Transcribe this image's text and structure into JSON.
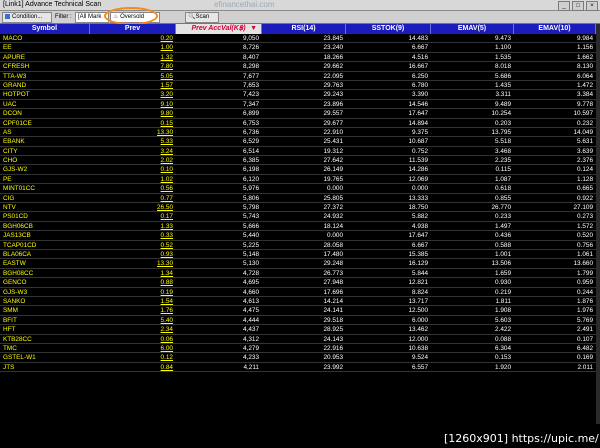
{
  "window": {
    "title": "[Link1] Advance Technical Scan",
    "watermark": "efinancethai.com"
  },
  "toolbar": {
    "condition_label": "Condition...",
    "filter_label": "Filter :",
    "market_value": "[All Mark",
    "oversold_label": "Oversold",
    "scan_label": "Scan"
  },
  "table": {
    "columns": [
      "Symbol",
      "Prev",
      "Prev AccVal(K฿)",
      "RSI(14)",
      "SSTOK(9)",
      "EMAV(5)",
      "EMAV(10)"
    ],
    "rows": [
      [
        "MACO",
        "0.20",
        "9,050",
        "23.845",
        "14.483",
        "9.473",
        "9.984"
      ],
      [
        "EE",
        "1.00",
        "8,726",
        "23.240",
        "6.667",
        "1.100",
        "1.156"
      ],
      [
        "APURE",
        "1.32",
        "8,407",
        "18.266",
        "4.516",
        "1.535",
        "1.662"
      ],
      [
        "CFRESH",
        "7.80",
        "8,298",
        "29.662",
        "16.667",
        "8.018",
        "8.130"
      ],
      [
        "TTA-W3",
        "5.05",
        "7,677",
        "22.095",
        "6.250",
        "5.686",
        "6.064"
      ],
      [
        "GRAND",
        "1.57",
        "7,653",
        "29.763",
        "6.780",
        "1.435",
        "1.472"
      ],
      [
        "HOTPOT",
        "3.20",
        "7,423",
        "29.243",
        "3.390",
        "3.311",
        "3.384"
      ],
      [
        "UAC",
        "9.10",
        "7,347",
        "23.896",
        "14.546",
        "9.489",
        "9.778"
      ],
      [
        "DCON",
        "9.80",
        "6,899",
        "29.557",
        "17.647",
        "10.254",
        "10.597"
      ],
      [
        "CPF01CE",
        "0.15",
        "6,753",
        "29.677",
        "14.894",
        "0.203",
        "0.232"
      ],
      [
        "AS",
        "13.30",
        "6,736",
        "22.910",
        "9.375",
        "13.795",
        "14.049"
      ],
      [
        "EBANK",
        "5.33",
        "6,529",
        "25.431",
        "10.687",
        "5.518",
        "5.631"
      ],
      [
        "CITY",
        "3.24",
        "6,514",
        "19.312",
        "0.752",
        "3.468",
        "3.639"
      ],
      [
        "CHO",
        "2.02",
        "6,385",
        "27.642",
        "11.539",
        "2.235",
        "2.376"
      ],
      [
        "GJS-W2",
        "0.10",
        "6,198",
        "26.149",
        "14.286",
        "0.115",
        "0.124"
      ],
      [
        "PE",
        "1.02",
        "6,120",
        "19.765",
        "12.069",
        "1.087",
        "1.128"
      ],
      [
        "MINT01CC",
        "0.56",
        "5,976",
        "0.000",
        "0.000",
        "0.618",
        "0.665"
      ],
      [
        "CIG",
        "0.77",
        "5,806",
        "25.805",
        "13.333",
        "0.855",
        "0.922"
      ],
      [
        "NTV",
        "26.50",
        "5,798",
        "27.372",
        "18.750",
        "26.770",
        "27.109"
      ],
      [
        "PS01CD",
        "0.17",
        "5,743",
        "24.932",
        "5.882",
        "0.233",
        "0.273"
      ],
      [
        "BGH06CB",
        "1.33",
        "5,666",
        "18.124",
        "4.938",
        "1.497",
        "1.572"
      ],
      [
        "JAS13CB",
        "0.33",
        "5,440",
        "0.000",
        "17.647",
        "0.436",
        "0.520"
      ],
      [
        "TCAP01CD",
        "0.52",
        "5,225",
        "28.058",
        "6.667",
        "0.588",
        "0.756"
      ],
      [
        "BLA06CA",
        "0.93",
        "5,148",
        "17.480",
        "15.385",
        "1.001",
        "1.061"
      ],
      [
        "EASTW",
        "13.30",
        "5,130",
        "29.248",
        "16.129",
        "13.506",
        "13.660"
      ],
      [
        "BGH08CC",
        "1.34",
        "4,728",
        "26.773",
        "5.844",
        "1.659",
        "1.799"
      ],
      [
        "GENCO",
        "0.88",
        "4,695",
        "27.948",
        "12.821",
        "0.930",
        "0.959"
      ],
      [
        "GJS-W3",
        "0.19",
        "4,660",
        "17.696",
        "8.824",
        "0.219",
        "0.244"
      ],
      [
        "SANKO",
        "1.54",
        "4,613",
        "14.214",
        "13.717",
        "1.811",
        "1.876"
      ],
      [
        "SMM",
        "1.76",
        "4,475",
        "24.141",
        "12.500",
        "1.908",
        "1.976"
      ],
      [
        "BFIT",
        "5.40",
        "4,444",
        "29.518",
        "6.000",
        "5.603",
        "5.769"
      ],
      [
        "HFT",
        "2.34",
        "4,437",
        "28.925",
        "13.462",
        "2.422",
        "2.491"
      ],
      [
        "KTB28CC",
        "0.06",
        "4,312",
        "24.143",
        "12.000",
        "0.088",
        "0.107"
      ],
      [
        "TMC",
        "6.00",
        "4,279",
        "22.916",
        "10.638",
        "6.304",
        "6.482"
      ],
      [
        "GSTEL-W1",
        "0.12",
        "4,233",
        "20.953",
        "9.524",
        "0.153",
        "0.169"
      ],
      [
        "JTS",
        "0.84",
        "4,211",
        "23.992",
        "6.557",
        "1.920",
        "2.011"
      ]
    ]
  },
  "footer": {
    "text": "[1260x901] https://upic.me/"
  }
}
